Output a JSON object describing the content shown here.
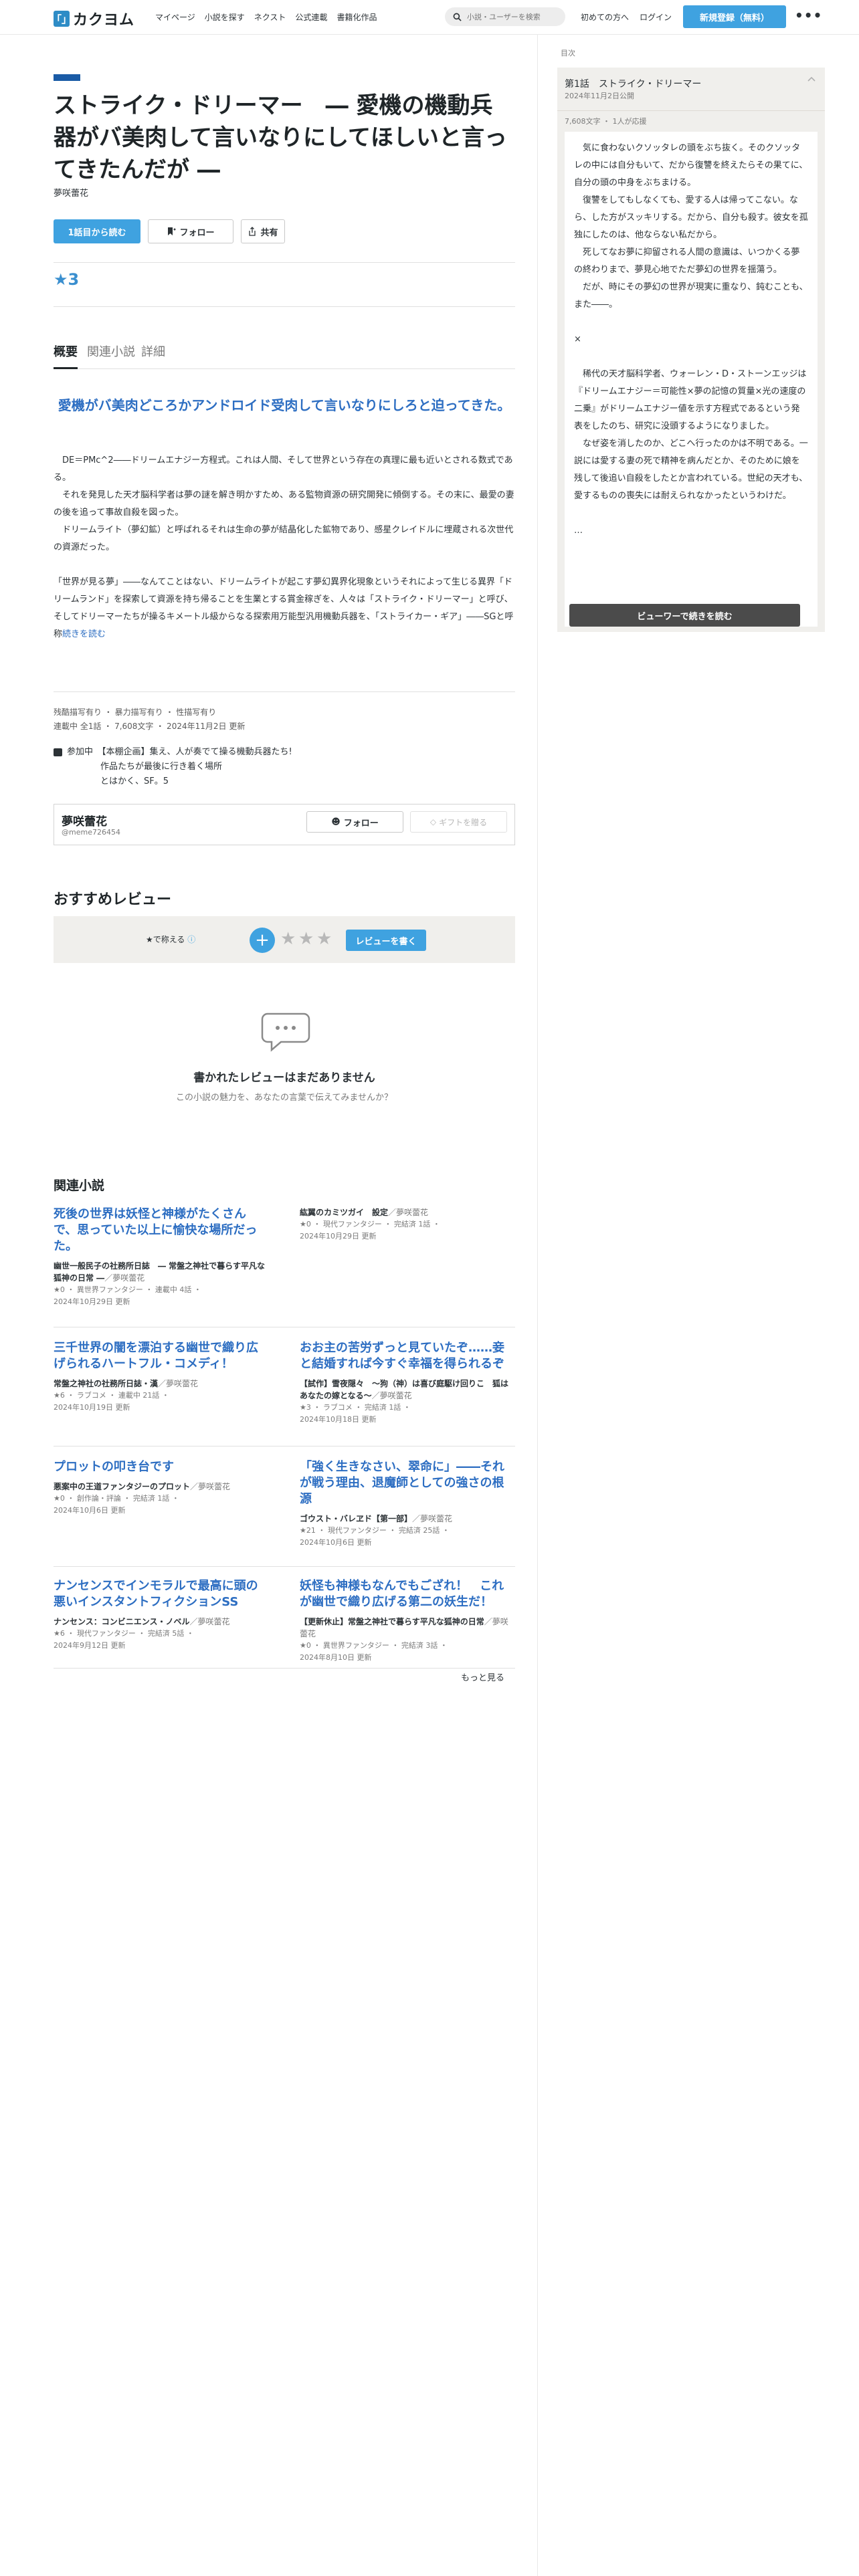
{
  "header": {
    "logo_mark": "「」",
    "logo_text": "カクヨム",
    "nav": [
      "マイページ",
      "小説を探す",
      "ネクスト",
      "公式連載",
      "書籍化作品"
    ],
    "search_placeholder": "小説・ユーザーを検索",
    "first_time": "初めての方へ",
    "login": "ログイン",
    "signup": "新規登録（無料）",
    "more": "•••"
  },
  "work": {
    "title": "ストライク・ドリーマー　― 愛機の機動兵器がバ美肉して言いなりにしてほしいと言ってきたんだが ―",
    "author": "夢咲蕾花",
    "buttons": {
      "read_first": "1話目から読む",
      "follow": "フォロー",
      "share": "共有"
    },
    "stars": "★3",
    "tabs": [
      "概要",
      "関連小説",
      "詳細"
    ],
    "catchphrase": "愛機がバ美肉どころかアンドロイド受肉して言いなりにしろと迫ってきた。",
    "intro": [
      "　DE＝PMc^2――ドリームエナジー方程式。これは人間、そして世界という存在の真理に最も近いとされる数式である。",
      "　それを発見した天才脳科学者は夢の謎を解き明かすため、ある監物資源の研究開発に傾倒する。その末に、最愛の妻の後を追って事故自殺を図った。",
      "　ドリームライト（夢幻鉱）と呼ばれるそれは生命の夢が結晶化した鉱物であり、感星クレイドルに埋蔵される次世代の資源だった。",
      "",
      "「世界が見る夢」――なんてことはない、ドリームライトが起こす夢幻異界化現象というそれによって生じる異界「ドリームランド」を探索して資源を持ち帰ることを生業とする賞金稼ぎを、人々は「ストライク・ドリーマー」と呼び、そしてドリーマーたちが操るキメートル級からなる探索用万能型汎用機動兵器を、「ストライカー・ギア」――SGと呼称"
    ],
    "intro_more": "続きを読む",
    "tags": "残酷描写有り ・ 暴力描写有り ・ 性描写有り",
    "stats": "連載中 全1話 ・ 7,608文字 ・ 2024年11月2日 更新",
    "event_label": "参加中",
    "event_lines": [
      "【本棚企画】集え、人が奏でて操る機動兵器たち!",
      "作品たちが最後に行き着く場所",
      "とはかく、SF。5"
    ],
    "author_card": {
      "name": "夢咲蕾花",
      "id": "@meme726454",
      "follow": "フォロー",
      "gift": "ギフトを贈る"
    }
  },
  "reviews": {
    "heading": "おすすめレビュー",
    "rate_label": "★で称える",
    "plus": "+",
    "star_glyph": "★",
    "write_button": "レビューを書く",
    "empty_title": "書かれたレビューはまだありません",
    "empty_sub": "この小説の魅力を、あなたの言葉で伝えてみませんか？"
  },
  "related": {
    "heading": "関連小説",
    "items": [
      {
        "title": "死後の世界は妖怪と神様がたくさんで、思っていた以上に愉快な場所だった。",
        "sub": "幽世一般民子の社務所日誌　― 常盤之神社で暮らす平凡な狐神の日常 ―",
        "author": "夢咲蕾花",
        "meta1": "★0 ・ 異世界ファンタジー ・ 連載中 4話 ・",
        "meta2": "2024年10月29日 更新",
        "plain": false
      },
      {
        "title": "紘翼のカミツガイ　設定",
        "sub": "",
        "author": "夢咲蕾花",
        "meta1": "★0 ・ 現代ファンタジー ・ 完結済 1話 ・",
        "meta2": "2024年10月29日 更新",
        "plain": true
      },
      {
        "title": "三千世界の闇を漂泊する幽世で織り広げられるハートフル・コメディ！",
        "sub": "常盤之神社の社務所日誌・漢",
        "author": "夢咲蕾花",
        "meta1": "★6 ・ ラブコメ ・ 連載中 21話 ・",
        "meta2": "2024年10月19日 更新",
        "plain": false
      },
      {
        "title": "おお主の苦労ずっと見ていたぞ……妾と結婚すれば今すぐ幸福を得られるぞ",
        "sub": "【試作】雪夜隠々　〜狗（神）は喜び庭駆け回りこ　狐はあなたの嫁となる〜",
        "author": "夢咲蕾花",
        "meta1": "★3 ・ ラブコメ ・ 完結済 1話 ・",
        "meta2": "2024年10月18日 更新",
        "plain": false
      },
      {
        "title": "プロットの叩き台です",
        "sub": "悪案中の王道ファンタジーのプロット",
        "author": "夢咲蕾花",
        "meta1": "★0 ・ 創作論・評論 ・ 完結済 1話 ・",
        "meta2": "2024年10月6日 更新",
        "plain": false
      },
      {
        "title": "「強く生きなさい、翠命に」――それが戦う理由、退魔師としての強さの根源",
        "sub": "ゴウスト・バレヱド【第一部】",
        "author": "夢咲蕾花",
        "meta1": "★21 ・ 現代ファンタジー ・ 完結済 25話 ・",
        "meta2": "2024年10月6日 更新",
        "plain": false
      },
      {
        "title": "ナンセンスでインモラルで最高に頭の悪いインスタントフィクションSS",
        "sub": "ナンセンス：コンビニエンス・ノベル",
        "author": "夢咲蕾花",
        "meta1": "★6 ・ 現代ファンタジー ・ 完結済 5話 ・",
        "meta2": "2024年9月12日 更新",
        "plain": false
      },
      {
        "title": "妖怪も神様もなんでもござれ！　これが幽世で織り広げる第二の妖生だ！",
        "sub": "【更新休止】常盤之神社で暮らす平凡な狐神の日常",
        "author": "夢咲蕾花",
        "meta1": "★0 ・ 異世界ファンタジー ・ 完結済 3話 ・",
        "meta2": "2024年8月10日 更新",
        "plain": false
      }
    ],
    "see_more": "もっと見る"
  },
  "sidebar": {
    "label": "目次",
    "episode_title": "第1話　ストライク・ドリーマー",
    "episode_date": "2024年11月2日公開",
    "episode_meta": "7,608文字 ・ 1人が応援",
    "excerpt": [
      "　気に食わないクソッタレの頭をぶち抜く。そのクソッタレの中には自分もいて、だから復讐を終えたらその果てに、自分の頭の中身をぶちまける。",
      "　復讐をしてもしなくても、愛する人は帰ってこない。なら、した方がスッキリする。だから、自分も殺す。彼女を孤独にしたのは、他ならない私だから。",
      "　死してなお夢に抑留される人間の意識は、いつかくる夢の終わりまで、夢見心地でただ夢幻の世界を揺蕩う。",
      "　だが、時にその夢幻の世界が現実に重なり、鈍むことも、また――。",
      "",
      "×",
      "",
      "　稀代の天才脳科学者、ウォーレン・D・ストーンエッジは『ドリームエナジー＝可能性×夢の記憶の質量×光の速度の二乗』がドリームエナジー値を示す方程式であるという発表をしたのち、研究に没頭するようになりました。",
      "　なぜ姿を消したのか、どこへ行ったのかは不明である。一説には愛する妻の死で精神を病んだとか、そのために娘を残して後追い自殺をしたとか言われている。世紀の天才も、愛するものの喪失には耐えられなかったというわけだ。",
      "",
      "…"
    ],
    "continue_button": "ビューワーで続きを読む"
  }
}
